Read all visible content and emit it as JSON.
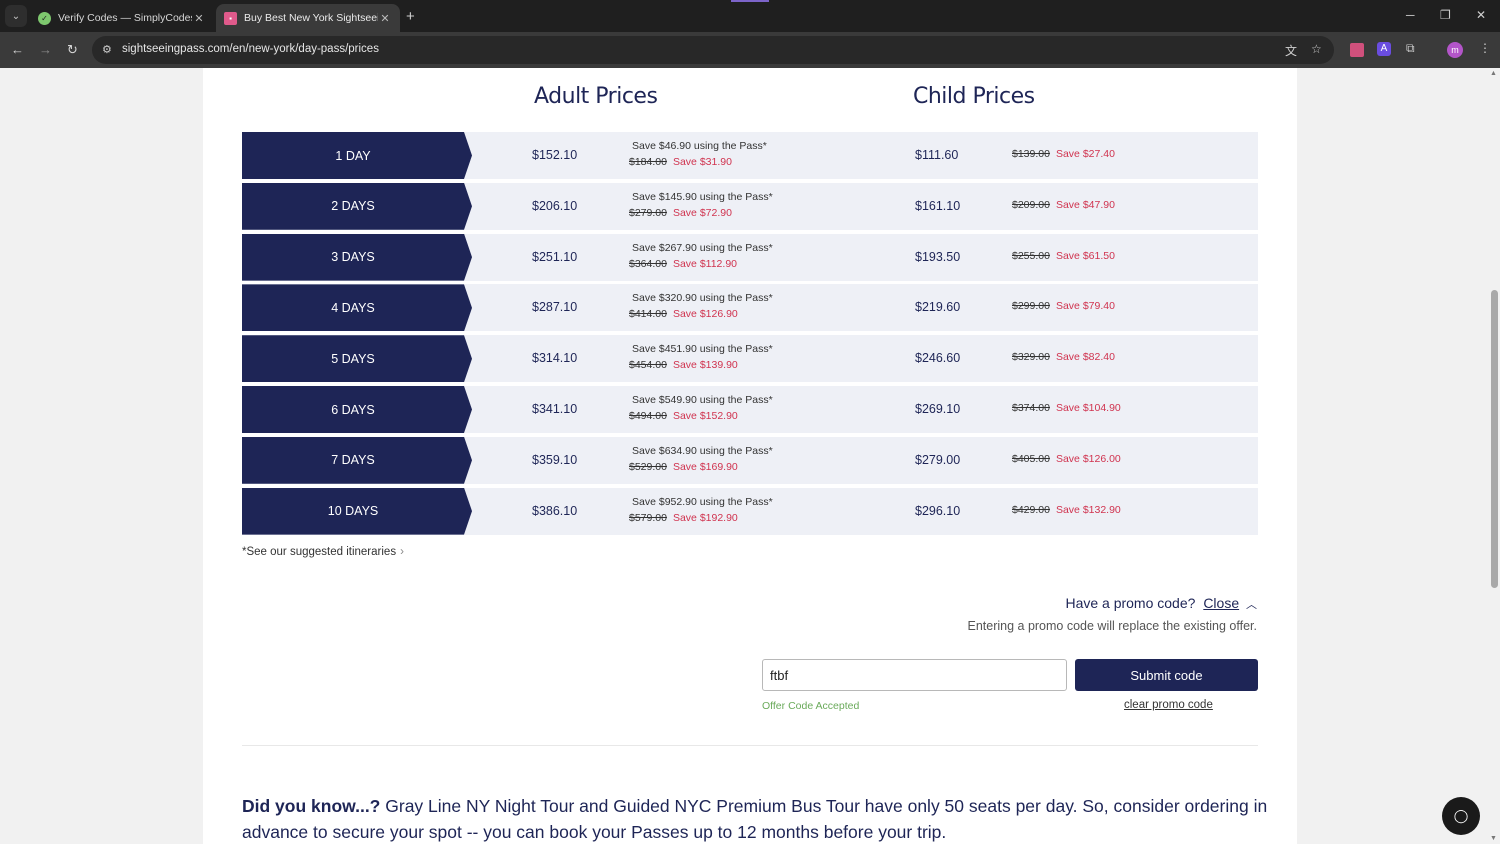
{
  "browser": {
    "tabs": [
      {
        "title": "Verify Codes — SimplyCodes",
        "active": false
      },
      {
        "title": "Buy Best New York Sightseeing",
        "active": true
      }
    ],
    "url": "sightseeingpass.com/en/new-york/day-pass/prices"
  },
  "prices": {
    "adult_heading": "Adult Prices",
    "child_heading": "Child Prices",
    "rows": [
      {
        "label": "1 DAY",
        "adult": "$152.10",
        "adult_pass_save": "Save $46.90 using the Pass*",
        "adult_orig": "$184.00",
        "adult_save": "Save $31.90",
        "child": "$111.60",
        "child_orig": "$139.00",
        "child_save": "Save $27.40"
      },
      {
        "label": "2 DAYS",
        "adult": "$206.10",
        "adult_pass_save": "Save $145.90 using the Pass*",
        "adult_orig": "$279.00",
        "adult_save": "Save $72.90",
        "child": "$161.10",
        "child_orig": "$209.00",
        "child_save": "Save $47.90"
      },
      {
        "label": "3 DAYS",
        "adult": "$251.10",
        "adult_pass_save": "Save $267.90 using the Pass*",
        "adult_orig": "$364.00",
        "adult_save": "Save $112.90",
        "child": "$193.50",
        "child_orig": "$255.00",
        "child_save": "Save $61.50"
      },
      {
        "label": "4 DAYS",
        "adult": "$287.10",
        "adult_pass_save": "Save $320.90 using the Pass*",
        "adult_orig": "$414.00",
        "adult_save": "Save $126.90",
        "child": "$219.60",
        "child_orig": "$299.00",
        "child_save": "Save $79.40"
      },
      {
        "label": "5 DAYS",
        "adult": "$314.10",
        "adult_pass_save": "Save $451.90 using the Pass*",
        "adult_orig": "$454.00",
        "adult_save": "Save $139.90",
        "child": "$246.60",
        "child_orig": "$329.00",
        "child_save": "Save $82.40"
      },
      {
        "label": "6 DAYS",
        "adult": "$341.10",
        "adult_pass_save": "Save $549.90 using the Pass*",
        "adult_orig": "$494.00",
        "adult_save": "Save $152.90",
        "child": "$269.10",
        "child_orig": "$374.00",
        "child_save": "Save $104.90"
      },
      {
        "label": "7 DAYS",
        "adult": "$359.10",
        "adult_pass_save": "Save $634.90 using the Pass*",
        "adult_orig": "$529.00",
        "adult_save": "Save $169.90",
        "child": "$279.00",
        "child_orig": "$405.00",
        "child_save": "Save $126.00"
      },
      {
        "label": "10 DAYS",
        "adult": "$386.10",
        "adult_pass_save": "Save $952.90 using the Pass*",
        "adult_orig": "$579.00",
        "adult_save": "Save $192.90",
        "child": "$296.10",
        "child_orig": "$429.00",
        "child_save": "Save $132.90"
      }
    ],
    "itineraries_link": "*See our suggested itineraries"
  },
  "promo": {
    "question": "Have a promo code?",
    "close_label": "Close",
    "note": "Entering a promo code will replace the existing offer.",
    "input_value": "ftbf",
    "submit_label": "Submit code",
    "status": "Offer Code Accepted",
    "clear_label": "clear promo code"
  },
  "did_you_know": {
    "lead": "Did you know...?",
    "text": " Gray Line NY Night Tour and Guided NYC Premium Bus Tour have only 50 seats per day. So, consider ordering in advance to secure your spot -- you can book your Passes up to 12 months before your trip."
  },
  "colors": {
    "navy": "#1e2556",
    "save_red": "#d0334f",
    "accepted_green": "#6aaa5a"
  }
}
